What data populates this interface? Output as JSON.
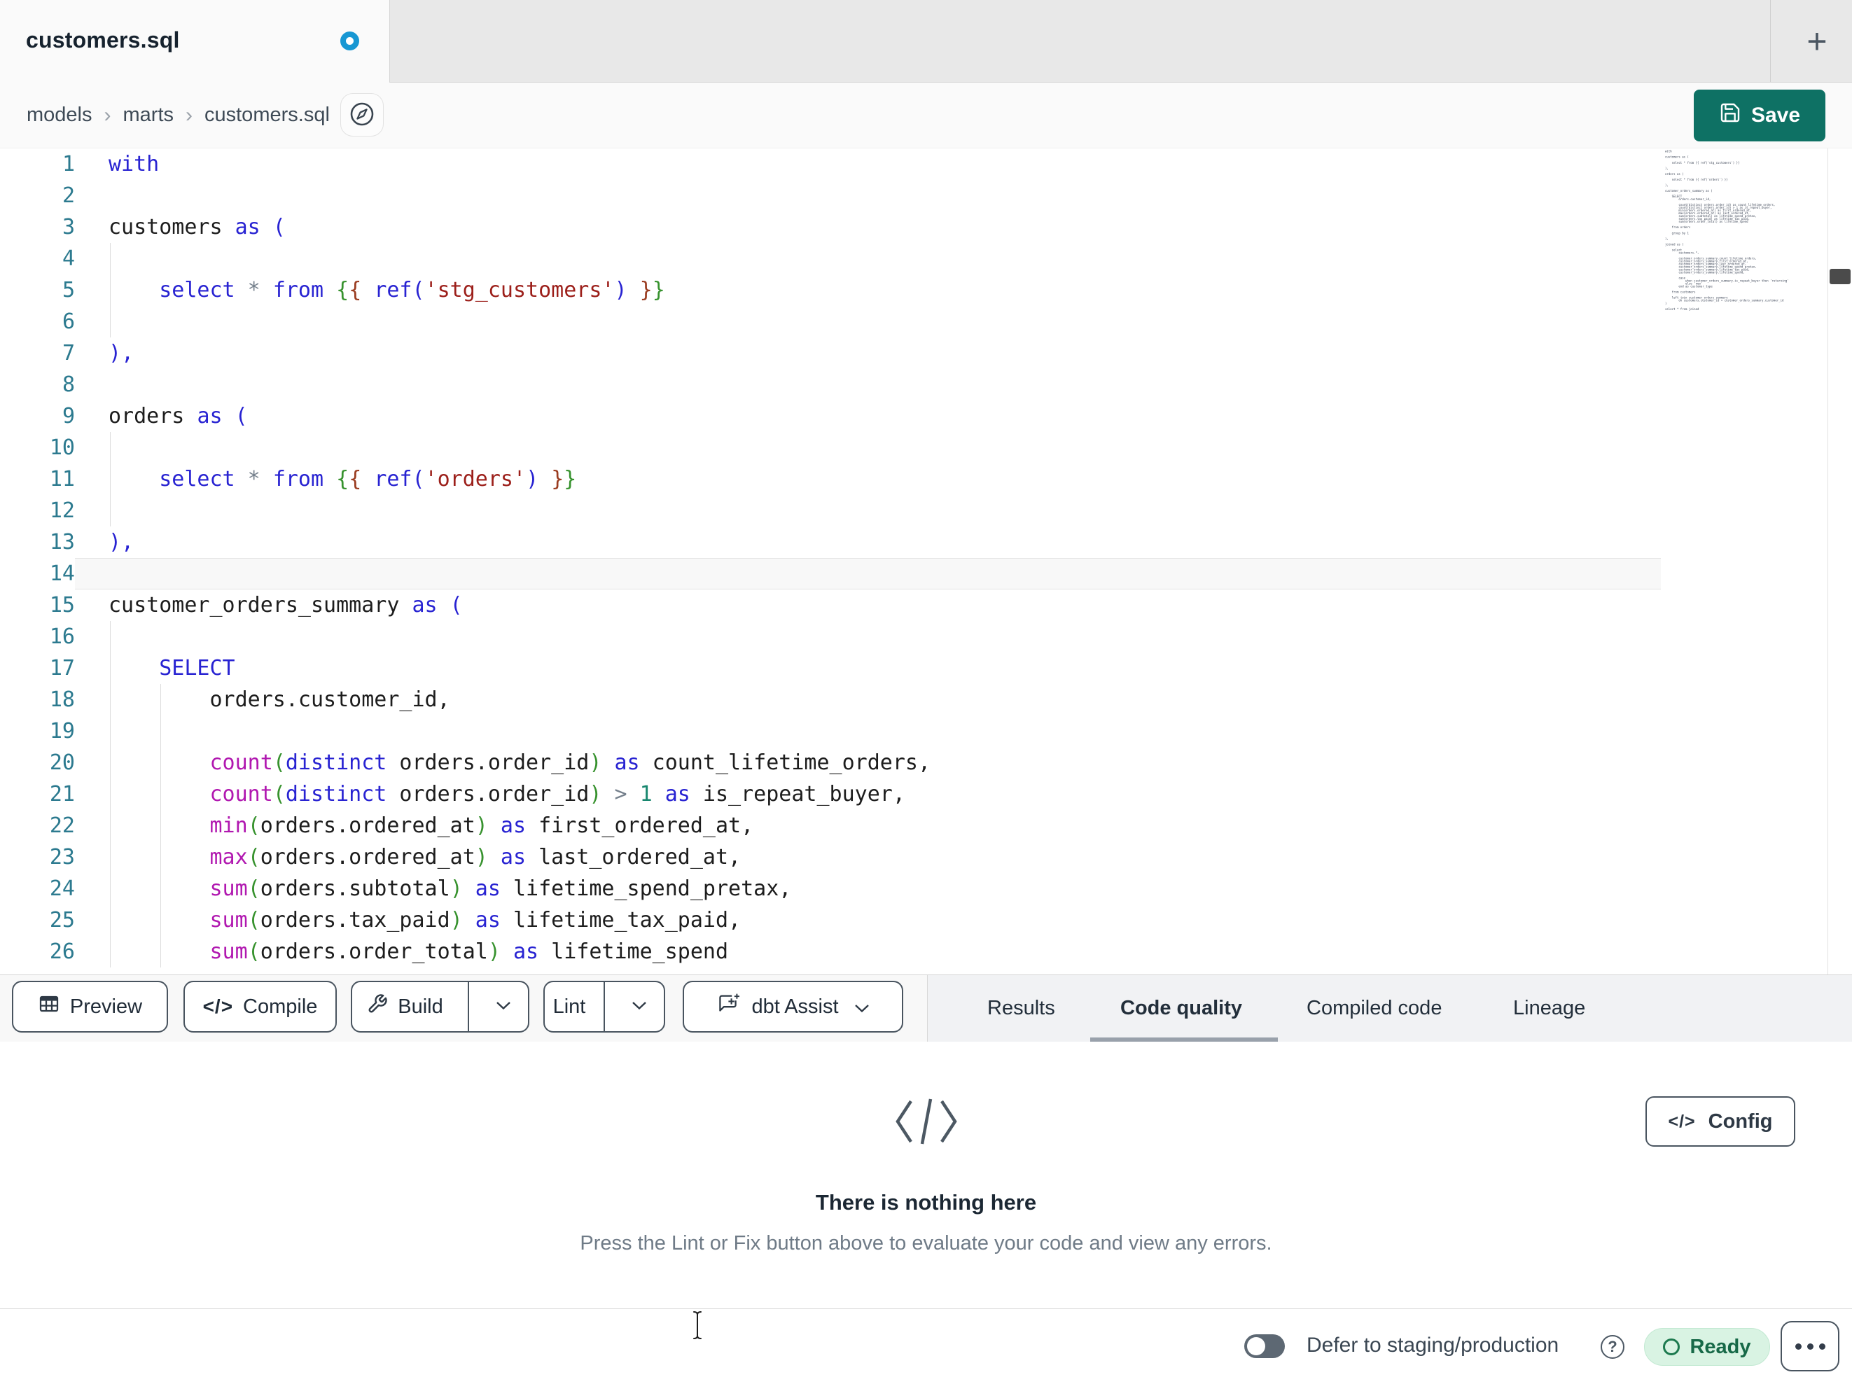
{
  "tabbar": {
    "tab_title": "customers.sql",
    "new_tab_label": "+"
  },
  "breadcrumb": {
    "items": [
      "models",
      "marts",
      "customers.sql"
    ],
    "separator": "›"
  },
  "actions": {
    "save_label": "Save"
  },
  "editor": {
    "lines": [
      {
        "n": 1,
        "tokens": [
          [
            "kw",
            "with"
          ]
        ]
      },
      {
        "n": 2,
        "tokens": []
      },
      {
        "n": 3,
        "tokens": [
          [
            "tx",
            "customers "
          ],
          [
            "kw",
            "as ("
          ]
        ]
      },
      {
        "n": 4,
        "tokens": []
      },
      {
        "n": 5,
        "tokens": [
          [
            "tx",
            "    "
          ],
          [
            "kw",
            "select"
          ],
          [
            "op",
            " * "
          ],
          [
            "kw",
            "from"
          ],
          [
            "tx",
            " "
          ],
          [
            "gr",
            "{"
          ],
          [
            "br",
            "{"
          ],
          [
            "tx",
            " "
          ],
          [
            "kw",
            "ref"
          ],
          [
            "kw",
            "("
          ],
          [
            "st",
            "'stg_customers'"
          ],
          [
            "kw",
            ")"
          ],
          [
            "tx",
            " "
          ],
          [
            "br",
            "}"
          ],
          [
            "gr",
            "}"
          ]
        ]
      },
      {
        "n": 6,
        "tokens": []
      },
      {
        "n": 7,
        "tokens": [
          [
            "kw",
            "),"
          ]
        ]
      },
      {
        "n": 8,
        "tokens": []
      },
      {
        "n": 9,
        "tokens": [
          [
            "tx",
            "orders "
          ],
          [
            "kw",
            "as ("
          ]
        ]
      },
      {
        "n": 10,
        "tokens": []
      },
      {
        "n": 11,
        "tokens": [
          [
            "tx",
            "    "
          ],
          [
            "kw",
            "select"
          ],
          [
            "op",
            " * "
          ],
          [
            "kw",
            "from"
          ],
          [
            "tx",
            " "
          ],
          [
            "gr",
            "{"
          ],
          [
            "br",
            "{"
          ],
          [
            "tx",
            " "
          ],
          [
            "kw",
            "ref"
          ],
          [
            "kw",
            "("
          ],
          [
            "st",
            "'orders'"
          ],
          [
            "kw",
            ")"
          ],
          [
            "tx",
            " "
          ],
          [
            "br",
            "}"
          ],
          [
            "gr",
            "}"
          ]
        ]
      },
      {
        "n": 12,
        "tokens": []
      },
      {
        "n": 13,
        "tokens": [
          [
            "kw",
            "),"
          ]
        ]
      },
      {
        "n": 14,
        "hl": true,
        "tokens": []
      },
      {
        "n": 15,
        "tokens": [
          [
            "tx",
            "customer_orders_summary "
          ],
          [
            "kw",
            "as ("
          ]
        ]
      },
      {
        "n": 16,
        "tokens": []
      },
      {
        "n": 17,
        "tokens": [
          [
            "tx",
            "    "
          ],
          [
            "kw",
            "SELECT"
          ]
        ]
      },
      {
        "n": 18,
        "tokens": [
          [
            "tx",
            "        orders.customer_id,"
          ]
        ]
      },
      {
        "n": 19,
        "tokens": []
      },
      {
        "n": 20,
        "tokens": [
          [
            "tx",
            "        "
          ],
          [
            "fn",
            "count"
          ],
          [
            "gr",
            "("
          ],
          [
            "kw",
            "distinct"
          ],
          [
            "tx",
            " orders.order_id"
          ],
          [
            "gr",
            ")"
          ],
          [
            "kw",
            " as"
          ],
          [
            "tx",
            " count_lifetime_orders,"
          ]
        ]
      },
      {
        "n": 21,
        "tokens": [
          [
            "tx",
            "        "
          ],
          [
            "fn",
            "count"
          ],
          [
            "gr",
            "("
          ],
          [
            "kw",
            "distinct"
          ],
          [
            "tx",
            " orders.order_id"
          ],
          [
            "gr",
            ")"
          ],
          [
            "op",
            " > "
          ],
          [
            "nu",
            "1"
          ],
          [
            "kw",
            " as"
          ],
          [
            "tx",
            " is_repeat_buyer,"
          ]
        ]
      },
      {
        "n": 22,
        "tokens": [
          [
            "tx",
            "        "
          ],
          [
            "fn",
            "min"
          ],
          [
            "gr",
            "("
          ],
          [
            "tx",
            "orders.ordered_at"
          ],
          [
            "gr",
            ")"
          ],
          [
            "kw",
            " as"
          ],
          [
            "tx",
            " first_ordered_at,"
          ]
        ]
      },
      {
        "n": 23,
        "tokens": [
          [
            "tx",
            "        "
          ],
          [
            "fn",
            "max"
          ],
          [
            "gr",
            "("
          ],
          [
            "tx",
            "orders.ordered_at"
          ],
          [
            "gr",
            ")"
          ],
          [
            "kw",
            " as"
          ],
          [
            "tx",
            " last_ordered_at,"
          ]
        ]
      },
      {
        "n": 24,
        "tokens": [
          [
            "tx",
            "        "
          ],
          [
            "fn",
            "sum"
          ],
          [
            "gr",
            "("
          ],
          [
            "tx",
            "orders.subtotal"
          ],
          [
            "gr",
            ")"
          ],
          [
            "kw",
            " as"
          ],
          [
            "tx",
            " lifetime_spend_pretax,"
          ]
        ]
      },
      {
        "n": 25,
        "tokens": [
          [
            "tx",
            "        "
          ],
          [
            "fn",
            "sum"
          ],
          [
            "gr",
            "("
          ],
          [
            "tx",
            "orders.tax_paid"
          ],
          [
            "gr",
            ")"
          ],
          [
            "kw",
            " as"
          ],
          [
            "tx",
            " lifetime_tax_paid,"
          ]
        ]
      },
      {
        "n": 26,
        "tokens": [
          [
            "tx",
            "        "
          ],
          [
            "fn",
            "sum"
          ],
          [
            "gr",
            "("
          ],
          [
            "tx",
            "orders.order_total"
          ],
          [
            "gr",
            ")"
          ],
          [
            "kw",
            " as"
          ],
          [
            "tx",
            " lifetime_spend"
          ]
        ]
      }
    ],
    "minimap_text": "with\n\ncustomers as (\n\n    select * from {{ ref('stg_customers') }}\n\n),\n\norders as (\n\n    select * from {{ ref('orders') }}\n\n),\n\ncustomer_orders_summary as (\n\n    SELECT\n        orders.customer_id,\n\n        count(distinct orders.order_id) as count_lifetime_orders,\n        count(distinct orders.order_id) > 1 as is_repeat_buyer,\n        min(orders.ordered_at) as first_ordered_at,\n        max(orders.ordered_at) as last_ordered_at,\n        sum(orders.subtotal) as lifetime_spend_pretax,\n        sum(orders.tax_paid) as lifetime_tax_paid,\n        sum(orders.order_total) as lifetime_spend\n\n    from orders\n\n    group by 1\n\n),\n\njoined as (\n\n    select\n        customers.*,\n\n        customer_orders_summary.count_lifetime_orders,\n        customer_orders_summary.first_ordered_at,\n        customer_orders_summary.last_ordered_at,\n        customer_orders_summary.lifetime_spend_pretax,\n        customer_orders_summary.lifetime_tax_paid,\n        customer_orders_summary.lifetime_spend,\n\n        case\n            when customer_orders_summary.is_repeat_buyer then 'returning'\n            else 'new'\n        end as customer_type\n\n    from customers\n\n    left join customer_orders_summary\n        on customers.customer_id = customer_orders_summary.customer_id\n)\n\nselect * from joined"
  },
  "toolbar": {
    "preview_label": "Preview",
    "compile_label": "Compile",
    "compile_icon": "</>",
    "build_label": "Build",
    "lint_label": "Lint",
    "assist_label": "dbt Assist"
  },
  "panel_tabs": {
    "results": "Results",
    "code_quality": "Code quality",
    "compiled_code": "Compiled code",
    "lineage": "Lineage"
  },
  "empty_state": {
    "title": "There is nothing here",
    "subtitle": "Press the Lint or Fix button above to evaluate your code and view any errors."
  },
  "config_button": {
    "label": "Config",
    "icon": "</>"
  },
  "statusbar": {
    "defer_label": "Defer to staging/production",
    "help_icon": "?",
    "ready_label": "Ready"
  },
  "colors": {
    "accent_teal": "#0E7164",
    "tab_modified_dot": "#1797D3",
    "ready_bg": "#D9F3E3",
    "ready_green": "#1D7A4F",
    "syntax_keyword": "#2823D2",
    "syntax_function": "#B118B0",
    "syntax_string": "#9C1F1A",
    "syntax_number": "#18876F",
    "syntax_operator": "#75808C",
    "syntax_bracket_green": "#37922E",
    "syntax_bracket_brown": "#9A3C20",
    "line_number": "#2C7A8F"
  }
}
